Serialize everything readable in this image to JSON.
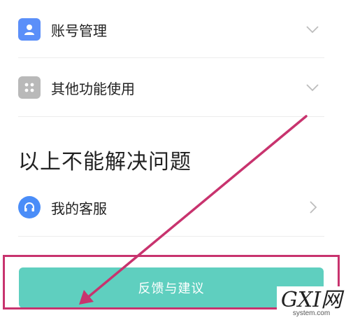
{
  "colors": {
    "account_icon_bg": "#5b8ff9",
    "other_icon_bg": "#b9b9b9",
    "service_icon_bg": "#4a8df8",
    "feedback_button_bg": "#5fcfbf",
    "annotation": "#c8336e",
    "divider": "#ececec"
  },
  "menu": {
    "account": {
      "label": "账号管理",
      "icon": "person-icon",
      "indicator": "chevron-down-icon"
    },
    "other": {
      "label": "其他功能使用",
      "icon": "grid-icon",
      "indicator": "chevron-down-icon"
    }
  },
  "section": {
    "title": "以上不能解决问题"
  },
  "service": {
    "label": "我的客服",
    "icon": "headset-icon",
    "indicator": "chevron-right-icon"
  },
  "feedback": {
    "label": "反馈与建议"
  },
  "watermark": {
    "logo_text": "GXI网",
    "sub_text": "system.com"
  }
}
